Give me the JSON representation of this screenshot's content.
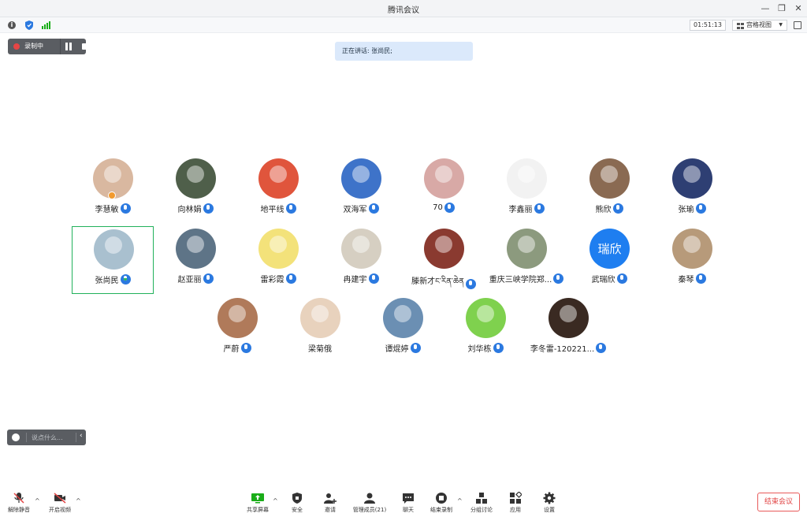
{
  "window": {
    "title": "腾讯会议"
  },
  "infobar": {
    "timer": "01:51:13",
    "view_label": "宫格视图"
  },
  "recording": {
    "label": "录制中"
  },
  "speaking": {
    "text": "正在讲话: 张尚民;"
  },
  "participants": [
    {
      "name": "李慧敏",
      "mic": "muted",
      "avatar_color": "#d9b8a0",
      "host": true
    },
    {
      "name": "向林娟",
      "mic": "muted",
      "avatar_color": "#4f5f4a"
    },
    {
      "name": "地平线",
      "mic": "muted",
      "avatar_color": "#e0553c"
    },
    {
      "name": "双海军",
      "mic": "muted",
      "avatar_color": "#3e73c9"
    },
    {
      "name": "70",
      "mic": "muted",
      "avatar_color": "#d8a9a6"
    },
    {
      "name": "李鑫丽",
      "mic": "muted",
      "avatar_color": "#f2f2f2"
    },
    {
      "name": "熊欣",
      "mic": "muted",
      "avatar_color": "#8a6a52"
    },
    {
      "name": "张瑜",
      "mic": "muted",
      "avatar_color": "#2e3f73"
    },
    {
      "name": "张尚民",
      "mic": "speaking",
      "avatar_color": "#a9c0cf",
      "active": true
    },
    {
      "name": "赵亚丽",
      "mic": "muted",
      "avatar_color": "#5e7487"
    },
    {
      "name": "雷彩霞",
      "mic": "muted",
      "avatar_color": "#f3e27a"
    },
    {
      "name": "冉建宇",
      "mic": "muted",
      "avatar_color": "#d6cfc2"
    },
    {
      "name": "滕新才ང་རིན་ཆེན",
      "mic": "muted",
      "avatar_color": "#8a3a30"
    },
    {
      "name": "重庆三峡学院郑...",
      "mic": "muted",
      "avatar_color": "#8c9a7e"
    },
    {
      "name": "武瑞欣",
      "mic": "muted",
      "avatar_color": "#1e7ef0",
      "avatar_text": "瑞欣"
    },
    {
      "name": "秦琴",
      "mic": "muted",
      "avatar_color": "#b79a7a"
    },
    {
      "name": "严蔚",
      "mic": "muted",
      "avatar_color": "#b07a5a"
    },
    {
      "name": "梁菊俄",
      "mic": "none",
      "avatar_color": "#e8d2bd"
    },
    {
      "name": "谭焜婷",
      "mic": "muted",
      "avatar_color": "#6b8fb3"
    },
    {
      "name": "刘华栋",
      "mic": "muted",
      "avatar_color": "#7fd14e"
    },
    {
      "name": "李冬雷-120221...",
      "mic": "muted",
      "avatar_color": "#3a2a22"
    }
  ],
  "chat": {
    "placeholder": "说点什么..."
  },
  "toolbar": {
    "unmute": "解除静音",
    "video": "开启视频",
    "share": "共享屏幕",
    "security": "安全",
    "invite": "邀请",
    "members": "管理成员(21)",
    "chat": "聊天",
    "end_recording": "结束录制",
    "breakout": "分组讨论",
    "apps": "应用",
    "settings": "设置",
    "end_meeting": "结束会议"
  },
  "colors": {
    "accent": "#2b79e0",
    "active_border": "#21b15b",
    "danger": "#e14444"
  }
}
